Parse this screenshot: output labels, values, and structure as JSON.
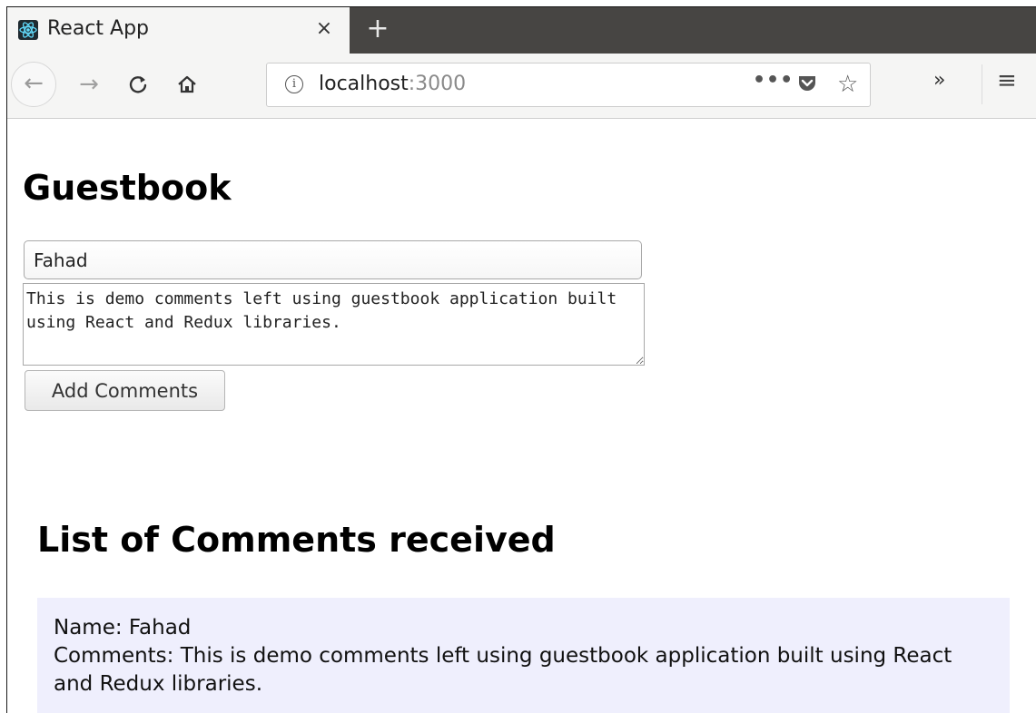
{
  "browser": {
    "tab_title": "React App",
    "tab_close": "×",
    "new_tab": "+",
    "url_host": "localhost",
    "url_port": ":3000",
    "nav_icons": {
      "back": "←",
      "forward": "→",
      "reload": "C",
      "home": "⌂",
      "info": "i",
      "page_actions": "•••",
      "pocket": "⛉",
      "bookmark": "☆",
      "overflow": "»",
      "menu": "≡"
    }
  },
  "page": {
    "title": "Guestbook",
    "name_value": "Fahad",
    "comment_value": "This is demo comments left using guestbook application built using React and Redux libraries.",
    "add_button_label": "Add Comments",
    "list_title": "List of Comments received",
    "comments": [
      {
        "name_line": "Name: Fahad",
        "comment_line": "Comments: This is demo comments left using guestbook application built using React and Redux libraries."
      }
    ]
  },
  "colors": {
    "tabstrip": "#474543",
    "toolbar": "#f5f5f4",
    "comment_card": "#efeffd"
  }
}
